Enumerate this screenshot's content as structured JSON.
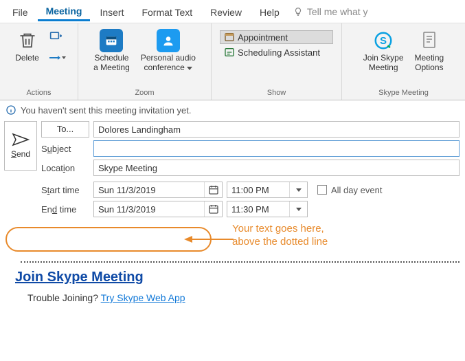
{
  "tabs": [
    "File",
    "Meeting",
    "Insert",
    "Format Text",
    "Review",
    "Help"
  ],
  "tellme": "Tell me what y",
  "ribbon": {
    "actions": {
      "title": "Actions",
      "delete": "Delete"
    },
    "zoom": {
      "title": "Zoom",
      "schedule": "Schedule\na Meeting",
      "audio": "Personal audio\nconference"
    },
    "show": {
      "title": "Show",
      "appointment": "Appointment",
      "scheduling": "Scheduling Assistant"
    },
    "skype": {
      "title": "Skype Meeting",
      "join": "Join Skype\nMeeting",
      "options": "Meeting\nOptions"
    }
  },
  "info": "You haven't sent this meeting invitation yet.",
  "form": {
    "send": "Send",
    "to_label": "To...",
    "to_value": "Dolores Landingham",
    "subject_label": "Subject",
    "subject_value": "",
    "location_label": "Location",
    "location_value": "Skype Meeting",
    "start_label": "Start time",
    "start_date": "Sun 11/3/2019",
    "start_time": "11:00 PM",
    "end_label": "End time",
    "end_date": "Sun 11/3/2019",
    "end_time": "11:30 PM",
    "allday": "All day event"
  },
  "callout": {
    "line1": "Your text goes here,",
    "line2": "above the dotted line"
  },
  "body": {
    "join": "Join Skype Meeting",
    "trouble": "Trouble Joining?",
    "try": "Try Skype Web App"
  }
}
